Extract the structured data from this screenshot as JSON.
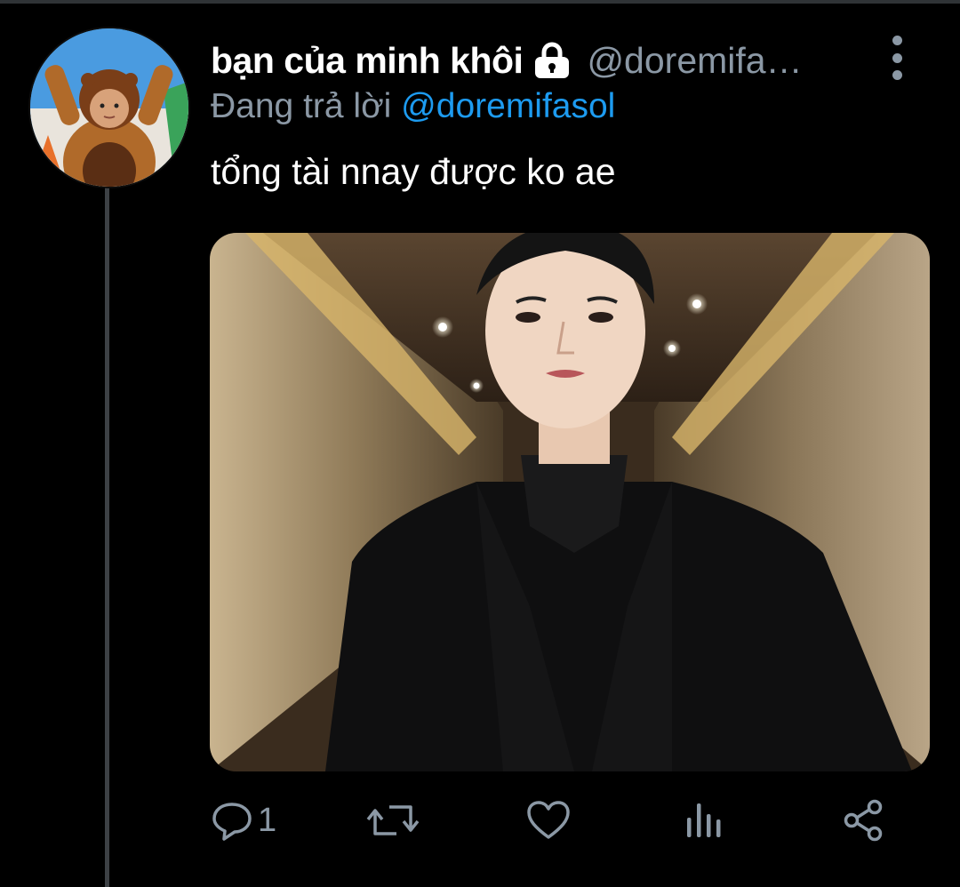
{
  "tweet": {
    "display_name": "bạn của minh khôi",
    "handle": "@doremifa…",
    "replying_prefix": "Đang trả lời",
    "replying_to": "@doremifasol",
    "text": "tổng tài nnay được ko ae",
    "locked": true
  },
  "actions": {
    "reply_count": "1",
    "retweet_count": "",
    "like_count": ""
  },
  "icons": {
    "lock": "lock-icon",
    "more": "more-vertical-icon",
    "reply": "reply-icon",
    "retweet": "retweet-icon",
    "like": "heart-icon",
    "analytics": "analytics-icon",
    "share": "share-icon"
  },
  "colors": {
    "background": "#000000",
    "secondary_text": "#8b98a5",
    "link": "#1d9bf0",
    "thread_line": "#3d4145"
  }
}
